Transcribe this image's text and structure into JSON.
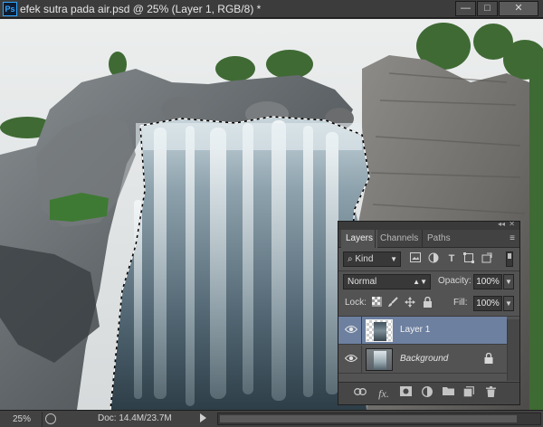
{
  "window": {
    "app_badge": "Ps",
    "title": "efek sutra pada air.psd @ 25% (Layer 1, RGB/8) *",
    "controls": {
      "minimize": "—",
      "maximize": "□",
      "close": "✕"
    }
  },
  "layers_panel": {
    "collapse_glyph": "◂◂",
    "close_glyph": "✕",
    "tabs": [
      "Layers",
      "Channels",
      "Paths"
    ],
    "active_tab": "Layers",
    "menu_glyph": "≡",
    "filter": {
      "label": "Kind",
      "icon": "search-icon"
    },
    "filter_icons": [
      "image-icon",
      "adjustment-icon",
      "type-icon",
      "shape-icon",
      "smart-object-icon"
    ],
    "blend_mode": "Normal",
    "opacity_label": "Opacity:",
    "opacity_value": "100%",
    "lock_label": "Lock:",
    "lock_icons": [
      "lock-pixels-icon",
      "lock-paint-icon",
      "lock-position-icon",
      "lock-all-icon"
    ],
    "fill_label": "Fill:",
    "fill_value": "100%",
    "layers": [
      {
        "name": "Layer 1",
        "visible": true,
        "selected": true,
        "locked": false
      },
      {
        "name": "Background",
        "visible": true,
        "selected": false,
        "locked": true
      }
    ],
    "footer_icons": [
      "link-icon",
      "fx-icon",
      "mask-icon",
      "adjustment-layer-icon",
      "group-icon",
      "new-layer-icon",
      "trash-icon"
    ],
    "footer_fx_label": "fx."
  },
  "status_bar": {
    "zoom": "25%",
    "doc_info": "Doc: 14.4M/23.7M"
  },
  "colors": {
    "panel": "#535353",
    "selected_layer": "#6d80a0",
    "ps_blue": "#31a8ff",
    "chrome": "#3c3c3c"
  }
}
